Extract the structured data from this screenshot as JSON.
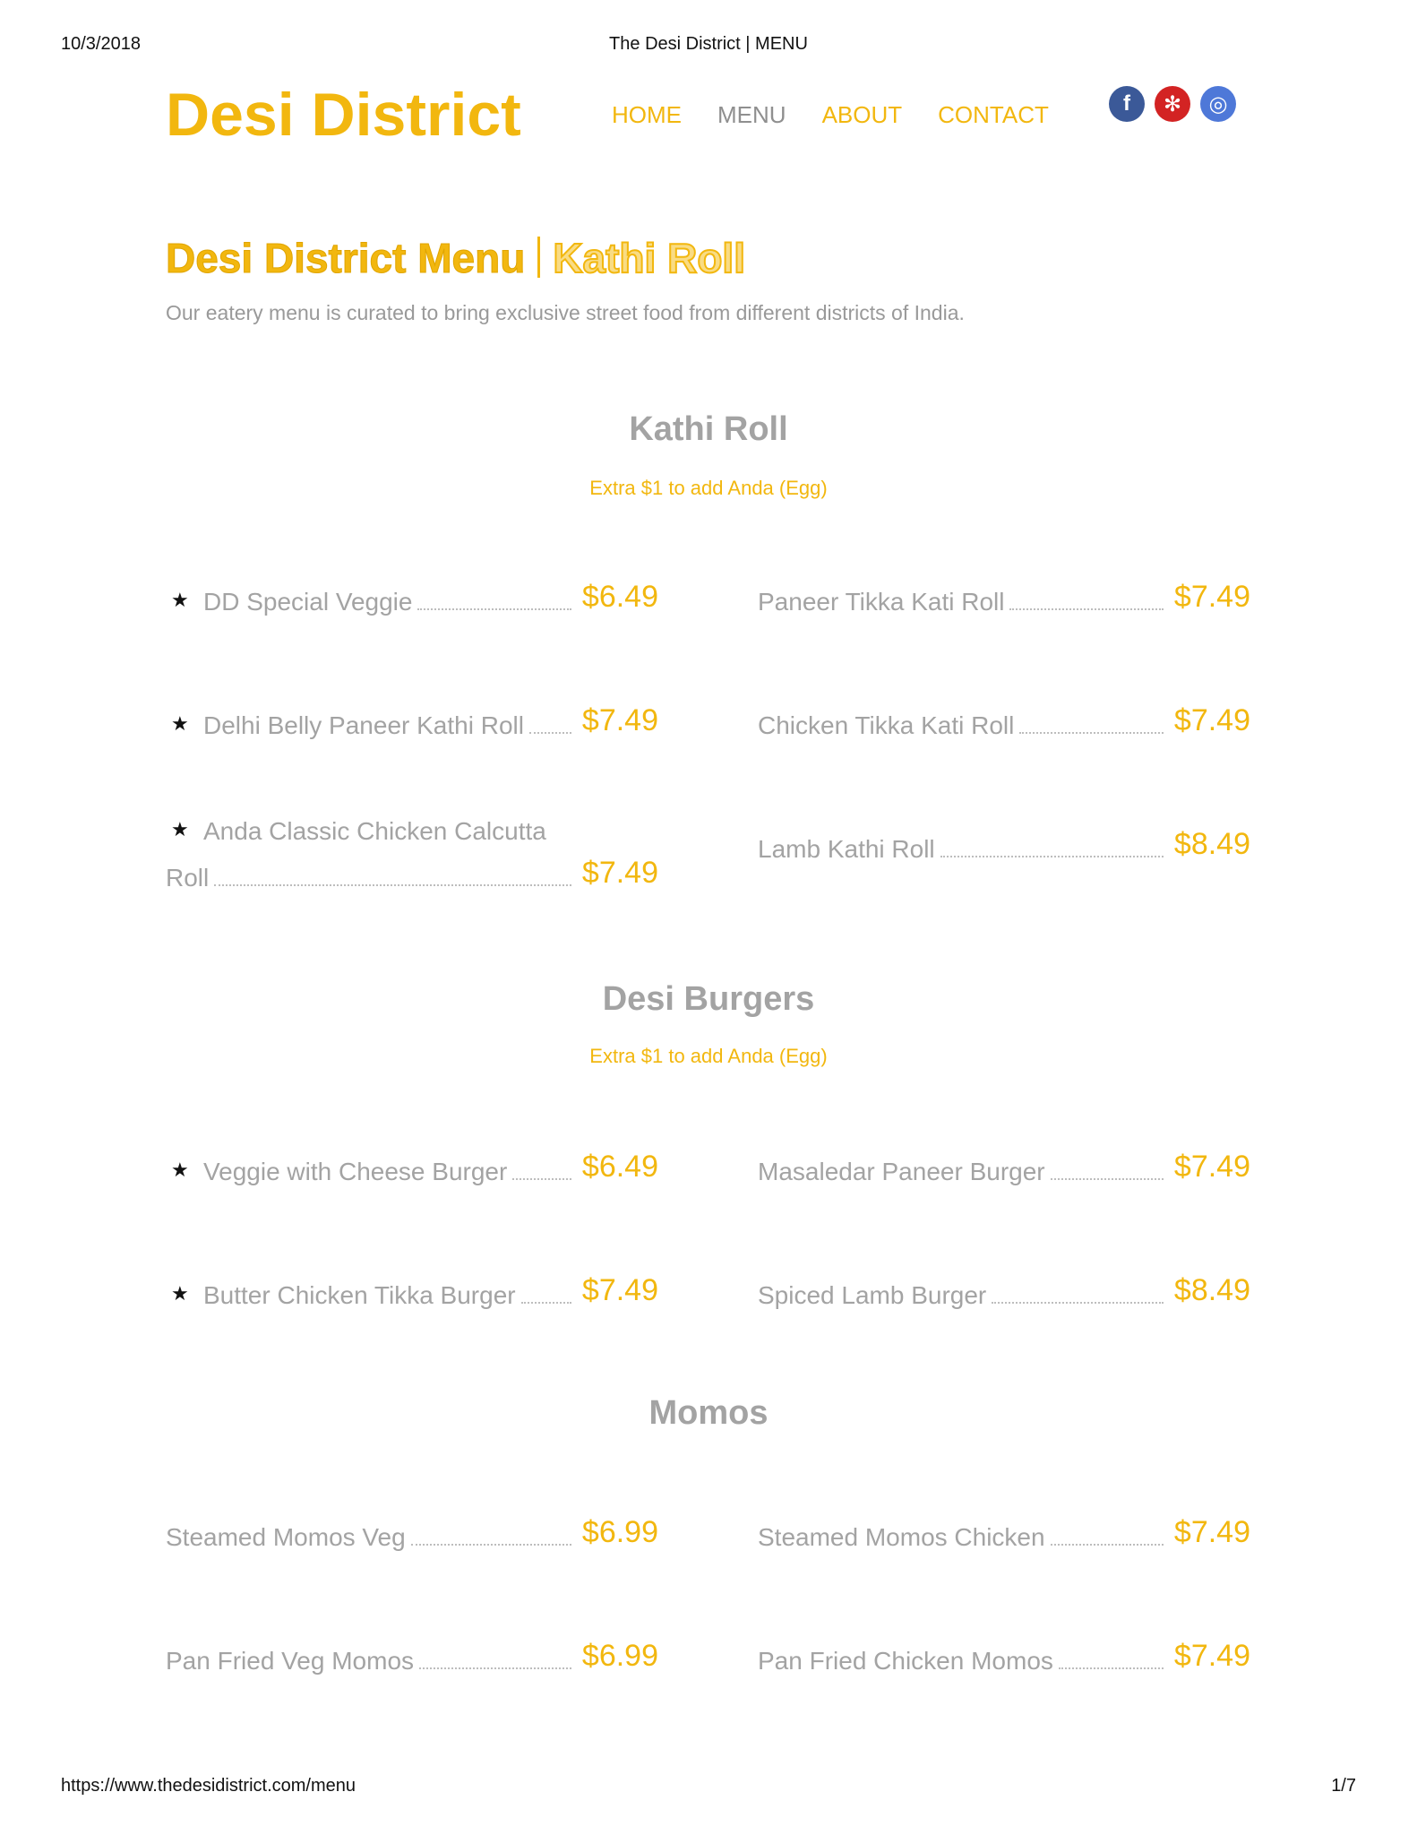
{
  "print_header": {
    "date": "10/3/2018",
    "title": "The Desi District | MENU"
  },
  "print_footer": {
    "url": "https://www.thedesidistrict.com/menu",
    "page": "1/7"
  },
  "site": {
    "logo": "Desi District",
    "nav": [
      {
        "label": "HOME",
        "active": false
      },
      {
        "label": "MENU",
        "active": true
      },
      {
        "label": "ABOUT",
        "active": false
      },
      {
        "label": "CONTACT",
        "active": false
      }
    ],
    "social": [
      {
        "icon": "facebook-icon",
        "glyph": "f",
        "color": "#3b5998"
      },
      {
        "icon": "yelp-icon",
        "glyph": "✻",
        "color": "#d32323"
      },
      {
        "icon": "instagram-icon",
        "glyph": "◎",
        "color": "#4e78d8"
      }
    ]
  },
  "page": {
    "heading_main": "Desi District Menu",
    "heading_sub": "Kathi Roll",
    "intro": "Our eatery menu is curated to bring exclusive street food from different districts of India."
  },
  "colors": {
    "accent": "#f2b70f",
    "text_muted": "#999999"
  },
  "sections": [
    {
      "title": "Kathi Roll",
      "note": "Extra $1 to add Anda (Egg)",
      "items": [
        {
          "name": "DD Special Veggie",
          "price": "$6.49",
          "starred": true
        },
        {
          "name": "Paneer Tikka Kati Roll",
          "price": "$7.49",
          "starred": false
        },
        {
          "name": "Delhi Belly Paneer Kathi Roll",
          "price": "$7.49",
          "starred": true
        },
        {
          "name": "Chicken Tikka Kati Roll",
          "price": "$7.49",
          "starred": false
        },
        {
          "name_line1": "Anda Classic Chicken Calcutta",
          "name": "Roll",
          "price": "$7.49",
          "starred": true
        },
        {
          "name": "Lamb Kathi Roll",
          "price": "$8.49",
          "starred": false
        }
      ]
    },
    {
      "title": "Desi Burgers",
      "note": "Extra $1 to add Anda (Egg)",
      "items": [
        {
          "name": "Veggie with Cheese Burger",
          "price": "$6.49",
          "starred": true
        },
        {
          "name": "Masaledar Paneer Burger",
          "price": "$7.49",
          "starred": false
        },
        {
          "name": "Butter Chicken Tikka Burger",
          "price": "$7.49",
          "starred": true
        },
        {
          "name": "Spiced Lamb Burger",
          "price": "$8.49",
          "starred": false
        }
      ]
    },
    {
      "title": "Momos",
      "note": "",
      "items": [
        {
          "name": "Steamed Momos Veg",
          "price": "$6.99",
          "starred": false
        },
        {
          "name": "Steamed Momos Chicken",
          "price": "$7.49",
          "starred": false
        },
        {
          "name": "Pan Fried Veg Momos",
          "price": "$6.99",
          "starred": false
        },
        {
          "name": "Pan Fried Chicken Momos",
          "price": "$7.49",
          "starred": false
        }
      ]
    }
  ]
}
